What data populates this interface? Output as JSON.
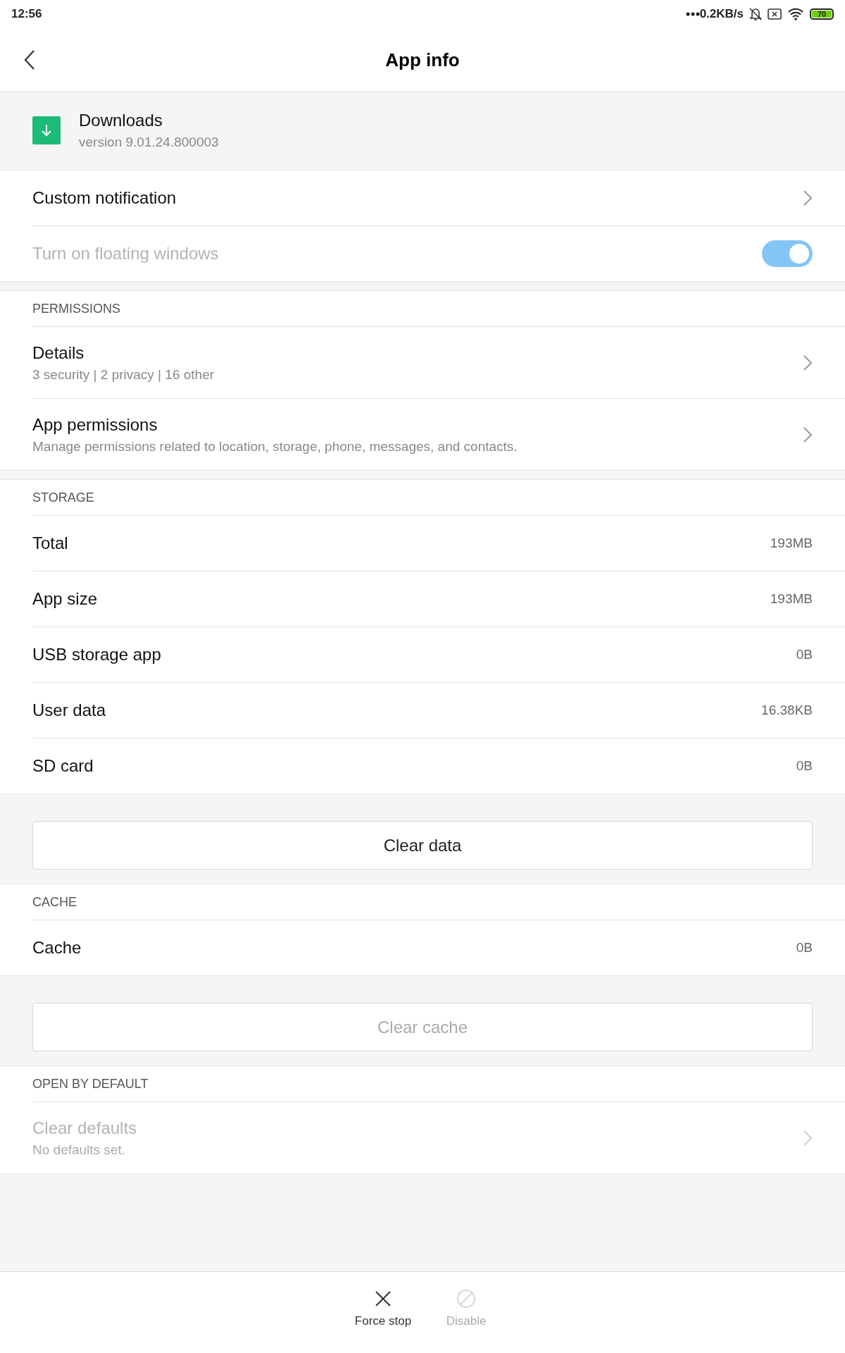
{
  "status_bar": {
    "time": "12:56",
    "network_speed": "0.2KB/s",
    "battery": "70"
  },
  "header": {
    "title": "App info"
  },
  "app": {
    "name": "Downloads",
    "version": "version 9.01.24.800003"
  },
  "groups": [
    {
      "rows": [
        {
          "kind": "link",
          "title": "Custom notification",
          "disabled": false
        },
        {
          "kind": "toggle",
          "title": "Turn on floating windows",
          "disabled": true,
          "on": true
        }
      ]
    },
    {
      "header": "PERMISSIONS",
      "rows": [
        {
          "kind": "link",
          "title": "Details",
          "subtitle": "3 security | 2 privacy | 16 other",
          "disabled": false
        },
        {
          "kind": "link",
          "title": "App permissions",
          "subtitle": "Manage permissions related to location, storage, phone, messages, and contacts.",
          "disabled": false
        }
      ]
    },
    {
      "header": "STORAGE",
      "rows": [
        {
          "kind": "value",
          "title": "Total",
          "value": "193MB"
        },
        {
          "kind": "value",
          "title": "App size",
          "value": "193MB"
        },
        {
          "kind": "value",
          "title": "USB storage app",
          "value": "0B"
        },
        {
          "kind": "value",
          "title": "User data",
          "value": "16.38KB"
        },
        {
          "kind": "value",
          "title": "SD card",
          "value": "0B"
        }
      ],
      "button": {
        "label": "Clear data",
        "disabled": false
      }
    },
    {
      "header": "CACHE",
      "rows": [
        {
          "kind": "value",
          "title": "Cache",
          "value": "0B"
        }
      ],
      "button": {
        "label": "Clear cache",
        "disabled": true
      }
    },
    {
      "header": "OPEN BY DEFAULT",
      "rows": [
        {
          "kind": "link",
          "title": "Clear defaults",
          "subtitle": "No defaults set.",
          "disabled": true
        }
      ]
    }
  ],
  "actions": [
    {
      "kind": "force_stop",
      "label": "Force stop",
      "disabled": false
    },
    {
      "kind": "disable",
      "label": "Disable",
      "disabled": true
    }
  ]
}
